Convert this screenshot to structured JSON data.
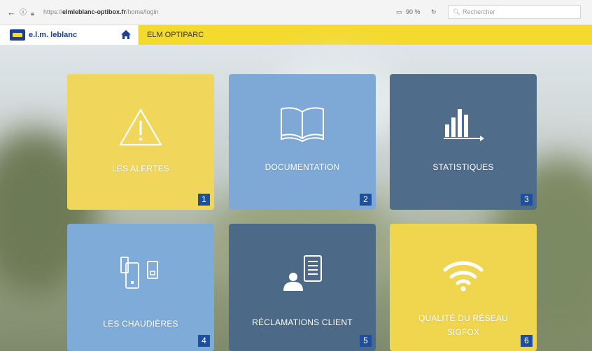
{
  "browser": {
    "url_prefix": "https://",
    "url_host": "elmleblanc-optibox.fr",
    "url_path": "/home/login",
    "zoom": "90 %",
    "search_placeholder": "Rechercher"
  },
  "appbar": {
    "logo_text": "e.l.m. leblanc",
    "title": "ELM OPTIPARC"
  },
  "colors": {
    "yellow": "#f4da2e",
    "blue_light": "#7aa7d5",
    "blue_dark": "#4f6d8c",
    "badge": "#1d4fa0"
  },
  "tiles": [
    {
      "label": "LES ALERTES",
      "number": "1",
      "icon": "warning-icon"
    },
    {
      "label": "DOCUMENTATION",
      "number": "2",
      "icon": "open-book-icon"
    },
    {
      "label": "STATISTIQUES",
      "number": "3",
      "icon": "bar-chart-icon"
    },
    {
      "label": "LES CHAUDIÈRES",
      "number": "4",
      "icon": "boiler-devices-icon"
    },
    {
      "label": "RÉCLAMATIONS CLIENT",
      "number": "5",
      "icon": "user-document-icon"
    },
    {
      "label_line1": "QUALITÉ DU RÉSEAU",
      "label_line2": "SIGFOX",
      "number": "6",
      "icon": "wifi-icon"
    }
  ]
}
